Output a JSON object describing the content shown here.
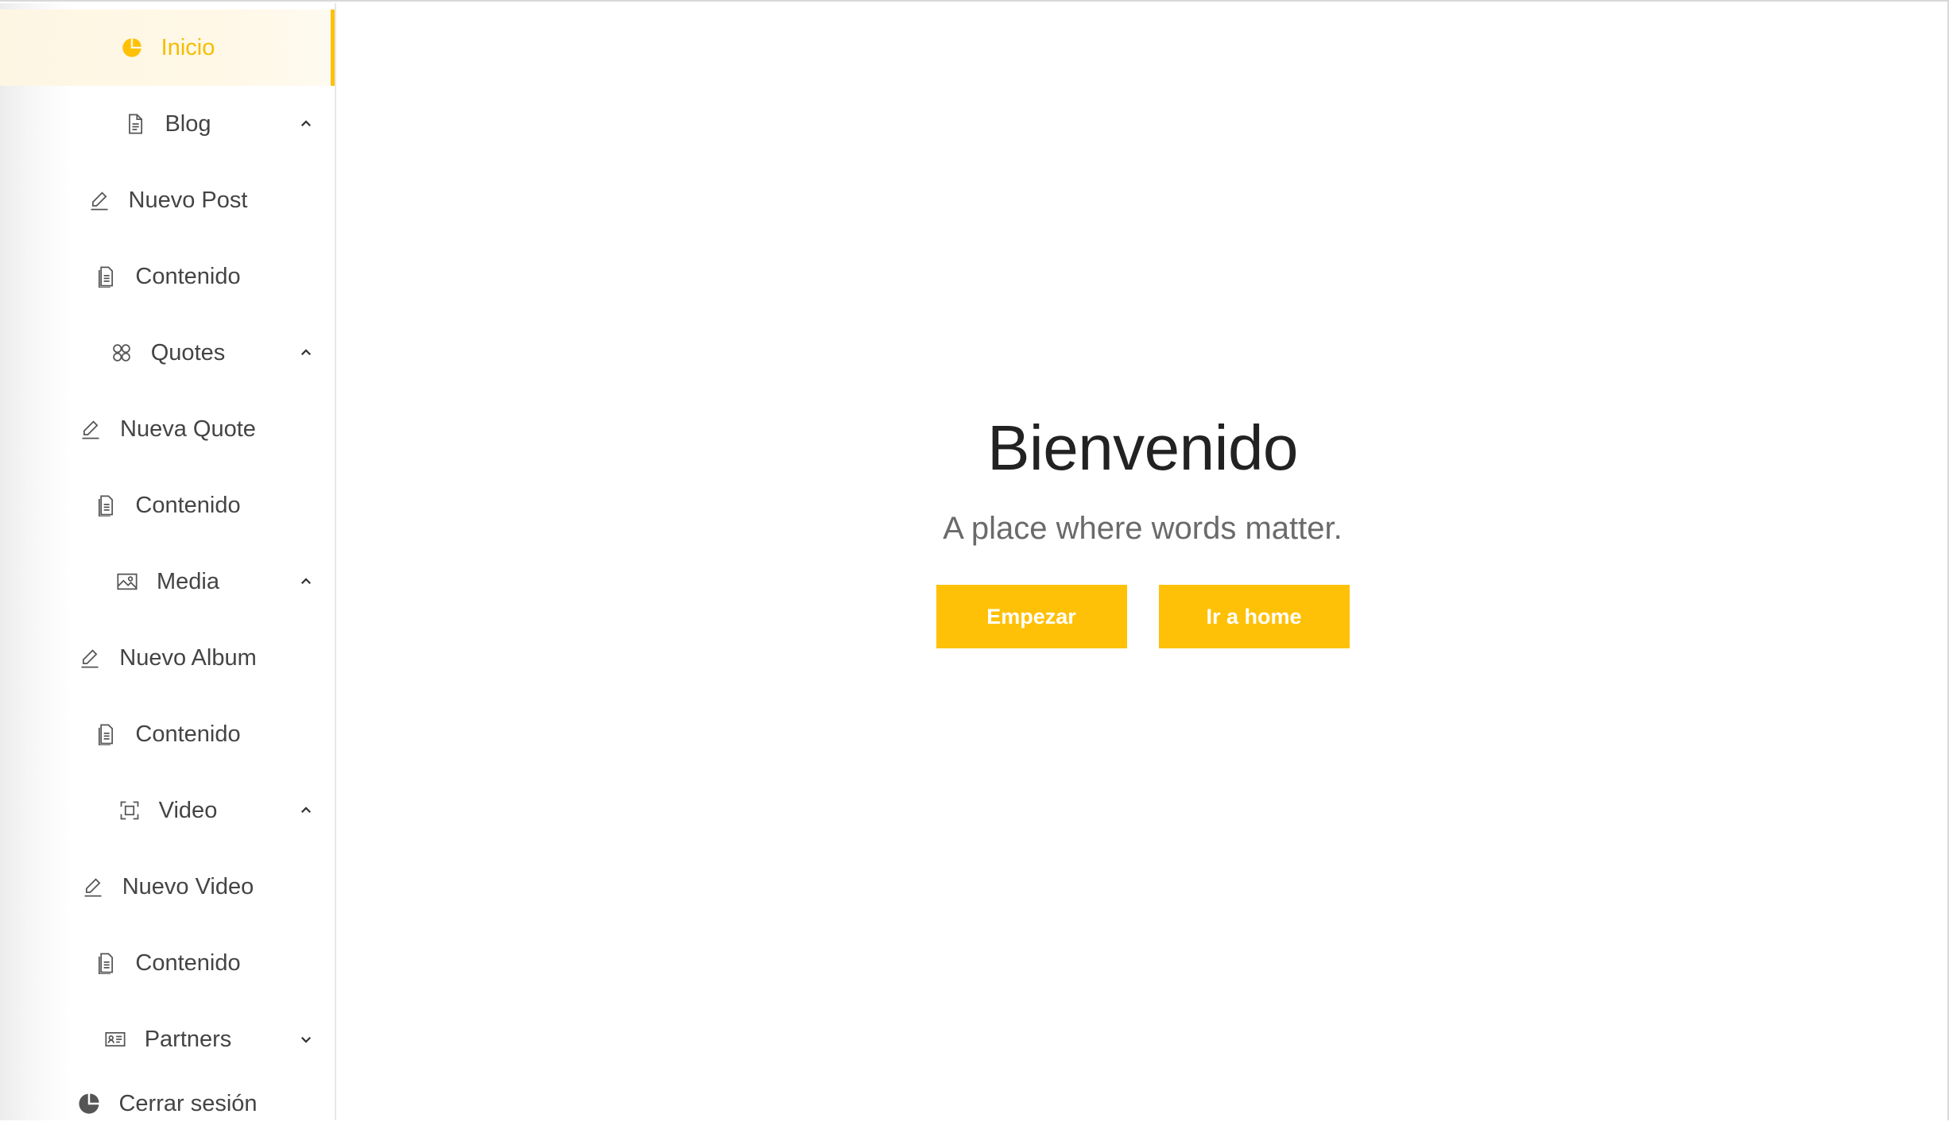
{
  "colors": {
    "accent": "#ffc107",
    "text": "#444444",
    "heading": "#222222",
    "subtle": "#6a6a6a"
  },
  "sidebar": {
    "items": [
      {
        "label": "Inicio",
        "icon": "pie-chart-icon",
        "active": true
      },
      {
        "label": "Blog",
        "icon": "document-icon",
        "expanded": true
      },
      {
        "label": "Nuevo Post",
        "icon": "pencil-icon"
      },
      {
        "label": "Contenido",
        "icon": "file-text-icon"
      },
      {
        "label": "Quotes",
        "icon": "apps-icon",
        "expanded": true
      },
      {
        "label": "Nueva Quote",
        "icon": "pencil-icon"
      },
      {
        "label": "Contenido",
        "icon": "file-text-icon"
      },
      {
        "label": "Media",
        "icon": "image-icon",
        "expanded": true
      },
      {
        "label": "Nuevo Album",
        "icon": "pencil-icon"
      },
      {
        "label": "Contenido",
        "icon": "file-text-icon"
      },
      {
        "label": "Video",
        "icon": "scan-icon",
        "expanded": true
      },
      {
        "label": "Nuevo Video",
        "icon": "pencil-icon"
      },
      {
        "label": "Contenido",
        "icon": "file-text-icon"
      },
      {
        "label": "Partners",
        "icon": "id-card-icon",
        "expanded": false
      }
    ],
    "logout": {
      "label": "Cerrar sesión",
      "icon": "pie-chart-icon"
    }
  },
  "main": {
    "title": "Bienvenido",
    "subtitle": "A place where words matter.",
    "buttons": {
      "start": "Empezar",
      "home": "Ir a home"
    }
  }
}
